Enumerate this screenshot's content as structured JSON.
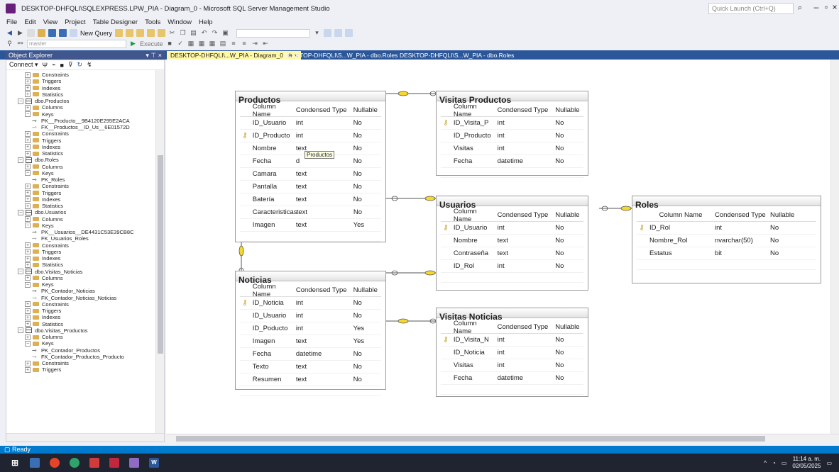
{
  "window": {
    "title": "DESKTOP-DHFQLI\\SQLEXPRESS.LPW_PIA - Diagram_0 - Microsoft SQL Server Management Studio",
    "quick_launch_placeholder": "Quick Launch (Ctrl+Q)",
    "accent": "#007acc"
  },
  "menu": [
    "File",
    "Edit",
    "View",
    "Project",
    "Table Designer",
    "Tools",
    "Window",
    "Help"
  ],
  "toolbar": {
    "new_query": "New Query",
    "database": "master",
    "execute": "Execute"
  },
  "object_explorer": {
    "title": "Object Explorer",
    "pin": "▾ ⊤ ×",
    "connect": "Connect ▾",
    "tree": [
      {
        "d": 2,
        "i": "folder",
        "e": "+",
        "t": "Constraints"
      },
      {
        "d": 2,
        "i": "folder",
        "e": "+",
        "t": "Triggers"
      },
      {
        "d": 2,
        "i": "folder",
        "e": "+",
        "t": "Indexes"
      },
      {
        "d": 2,
        "i": "folder",
        "e": "+",
        "t": "Statistics"
      },
      {
        "d": 1,
        "i": "table",
        "e": "−",
        "t": "dbo.Productos"
      },
      {
        "d": 2,
        "i": "folder",
        "e": "+",
        "t": "Columns"
      },
      {
        "d": 2,
        "i": "folder",
        "e": "−",
        "t": "Keys"
      },
      {
        "d": 3,
        "i": "pk",
        "e": "",
        "t": "PK__Producto__9B4120E295E2ACA"
      },
      {
        "d": 3,
        "i": "fk",
        "e": "",
        "t": "FK__Productos__ID_Us__6E01572D"
      },
      {
        "d": 2,
        "i": "folder",
        "e": "+",
        "t": "Constraints"
      },
      {
        "d": 2,
        "i": "folder",
        "e": "+",
        "t": "Triggers"
      },
      {
        "d": 2,
        "i": "folder",
        "e": "+",
        "t": "Indexes"
      },
      {
        "d": 2,
        "i": "folder",
        "e": "+",
        "t": "Statistics"
      },
      {
        "d": 1,
        "i": "table",
        "e": "−",
        "t": "dbo.Roles"
      },
      {
        "d": 2,
        "i": "folder",
        "e": "+",
        "t": "Columns"
      },
      {
        "d": 2,
        "i": "folder",
        "e": "−",
        "t": "Keys"
      },
      {
        "d": 3,
        "i": "pk",
        "e": "",
        "t": "PK_Roles"
      },
      {
        "d": 2,
        "i": "folder",
        "e": "+",
        "t": "Constraints"
      },
      {
        "d": 2,
        "i": "folder",
        "e": "+",
        "t": "Triggers"
      },
      {
        "d": 2,
        "i": "folder",
        "e": "+",
        "t": "Indexes"
      },
      {
        "d": 2,
        "i": "folder",
        "e": "+",
        "t": "Statistics"
      },
      {
        "d": 1,
        "i": "table",
        "e": "−",
        "t": "dbo.Usuarios"
      },
      {
        "d": 2,
        "i": "folder",
        "e": "+",
        "t": "Columns"
      },
      {
        "d": 2,
        "i": "folder",
        "e": "−",
        "t": "Keys"
      },
      {
        "d": 3,
        "i": "pk",
        "e": "",
        "t": "PK__Usuarios__DE4431C53E39CB8C"
      },
      {
        "d": 3,
        "i": "fk",
        "e": "",
        "t": "FK_Usuarios_Roles"
      },
      {
        "d": 2,
        "i": "folder",
        "e": "+",
        "t": "Constraints"
      },
      {
        "d": 2,
        "i": "folder",
        "e": "+",
        "t": "Triggers"
      },
      {
        "d": 2,
        "i": "folder",
        "e": "+",
        "t": "Indexes"
      },
      {
        "d": 2,
        "i": "folder",
        "e": "+",
        "t": "Statistics"
      },
      {
        "d": 1,
        "i": "table",
        "e": "−",
        "t": "dbo.Visitas_Noticias"
      },
      {
        "d": 2,
        "i": "folder",
        "e": "+",
        "t": "Columns"
      },
      {
        "d": 2,
        "i": "folder",
        "e": "−",
        "t": "Keys"
      },
      {
        "d": 3,
        "i": "pk",
        "e": "",
        "t": "PK_Contador_Noticias"
      },
      {
        "d": 3,
        "i": "fk",
        "e": "",
        "t": "FK_Contador_Noticias_Noticias"
      },
      {
        "d": 2,
        "i": "folder",
        "e": "+",
        "t": "Constraints"
      },
      {
        "d": 2,
        "i": "folder",
        "e": "+",
        "t": "Triggers"
      },
      {
        "d": 2,
        "i": "folder",
        "e": "+",
        "t": "Indexes"
      },
      {
        "d": 2,
        "i": "folder",
        "e": "+",
        "t": "Statistics"
      },
      {
        "d": 1,
        "i": "table",
        "e": "−",
        "t": "dbo.Visitas_Productos"
      },
      {
        "d": 2,
        "i": "folder",
        "e": "+",
        "t": "Columns"
      },
      {
        "d": 2,
        "i": "folder",
        "e": "−",
        "t": "Keys"
      },
      {
        "d": 3,
        "i": "pk",
        "e": "",
        "t": "PK_Contador_Productos"
      },
      {
        "d": 3,
        "i": "fk",
        "e": "",
        "t": "FK_Contador_Productos_Producto"
      },
      {
        "d": 2,
        "i": "folder",
        "e": "+",
        "t": "Constraints"
      },
      {
        "d": 2,
        "i": "folder",
        "e": "+",
        "t": "Triggers"
      }
    ]
  },
  "tabs": [
    {
      "label": "DESKTOP-DHFQLI\\...W_PIA - Diagram_0",
      "active": true,
      "close": "⊕ ×"
    },
    {
      "label": "DESKTOP-DHFQLI\\S...W_PIA - dbo.Roles",
      "active": false,
      "close": ""
    },
    {
      "label": "DESKTOP-DHFQLI\\S...W_PIA - dbo.Roles",
      "active": false,
      "close": ""
    }
  ],
  "diagram": {
    "headers": [
      "Column Name",
      "Condensed Type",
      "Nullable"
    ],
    "tooltip": "Productos",
    "tables": [
      {
        "name": "Productos",
        "cols": [
          {
            "pk": false,
            "n": "ID_Usuario",
            "t": "int",
            "nl": "No"
          },
          {
            "pk": true,
            "n": "ID_Producto",
            "t": "int",
            "nl": "No"
          },
          {
            "pk": false,
            "n": "Nombre",
            "t": "text",
            "nl": "No"
          },
          {
            "pk": false,
            "n": "Fecha",
            "t": "d",
            "nl": "No"
          },
          {
            "pk": false,
            "n": "Camara",
            "t": "text",
            "nl": "No"
          },
          {
            "pk": false,
            "n": "Pantalla",
            "t": "text",
            "nl": "No"
          },
          {
            "pk": false,
            "n": "Batería",
            "t": "text",
            "nl": "No"
          },
          {
            "pk": false,
            "n": "Caracteristicas",
            "t": "text",
            "nl": "No"
          },
          {
            "pk": false,
            "n": "Imagen",
            "t": "text",
            "nl": "Yes"
          }
        ]
      },
      {
        "name": "Visitas Productos",
        "cols": [
          {
            "pk": true,
            "n": "ID_Visita_P",
            "t": "int",
            "nl": "No"
          },
          {
            "pk": false,
            "n": "ID_Producto",
            "t": "int",
            "nl": "No"
          },
          {
            "pk": false,
            "n": "Visitas",
            "t": "int",
            "nl": "No"
          },
          {
            "pk": false,
            "n": "Fecha",
            "t": "datetime",
            "nl": "No"
          }
        ]
      },
      {
        "name": "Usuarios",
        "cols": [
          {
            "pk": true,
            "n": "ID_Usuario",
            "t": "int",
            "nl": "No"
          },
          {
            "pk": false,
            "n": "Nombre",
            "t": "text",
            "nl": "No"
          },
          {
            "pk": false,
            "n": "Contraseña",
            "t": "text",
            "nl": "No"
          },
          {
            "pk": false,
            "n": "ID_Rol",
            "t": "int",
            "nl": "No"
          }
        ]
      },
      {
        "name": "Roles",
        "cols": [
          {
            "pk": true,
            "n": "ID_Rol",
            "t": "int",
            "nl": "No"
          },
          {
            "pk": false,
            "n": "Nombre_Rol",
            "t": "nvarchar(50)",
            "nl": "No"
          },
          {
            "pk": false,
            "n": "Estatus",
            "t": "bit",
            "nl": "No"
          }
        ]
      },
      {
        "name": "Noticias",
        "cols": [
          {
            "pk": true,
            "n": "ID_Noticia",
            "t": "int",
            "nl": "No"
          },
          {
            "pk": false,
            "n": "ID_Usuario",
            "t": "int",
            "nl": "No"
          },
          {
            "pk": false,
            "n": "ID_Poducto",
            "t": "int",
            "nl": "Yes"
          },
          {
            "pk": false,
            "n": "Imagen",
            "t": "text",
            "nl": "Yes"
          },
          {
            "pk": false,
            "n": "Fecha",
            "t": "datetime",
            "nl": "No"
          },
          {
            "pk": false,
            "n": "Texto",
            "t": "text",
            "nl": "No"
          },
          {
            "pk": false,
            "n": "Resumen",
            "t": "text",
            "nl": "No"
          }
        ]
      },
      {
        "name": "Visitas Noticias",
        "cols": [
          {
            "pk": true,
            "n": "ID_Visita_N",
            "t": "int",
            "nl": "No"
          },
          {
            "pk": false,
            "n": "ID_Noticia",
            "t": "int",
            "nl": "No"
          },
          {
            "pk": false,
            "n": "Visitas",
            "t": "int",
            "nl": "No"
          },
          {
            "pk": false,
            "n": "Fecha",
            "t": "datetime",
            "nl": "No"
          }
        ]
      }
    ]
  },
  "status": {
    "text": "Ready"
  },
  "taskbar": {
    "time": "11:14 a. m.",
    "date": "02/05/2025"
  }
}
